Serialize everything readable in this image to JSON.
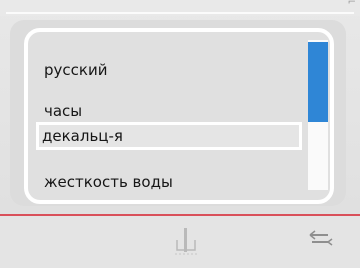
{
  "menu": {
    "items": [
      {
        "label": "русский"
      },
      {
        "label": "часы"
      },
      {
        "label": "декальц-я"
      },
      {
        "label": "жесткость воды"
      }
    ],
    "selected_index": 2
  },
  "scrollbar": {
    "position": 0.0,
    "visible_fraction": 0.55
  },
  "icons": {
    "bottom_center": "fine-tune-icon",
    "bottom_right": "swap-arrows-icon"
  },
  "colors": {
    "accent_blue": "#2f86d6",
    "divider_red": "#d9505a",
    "background": "#e3e3e3",
    "highlight": "#ffffff"
  }
}
